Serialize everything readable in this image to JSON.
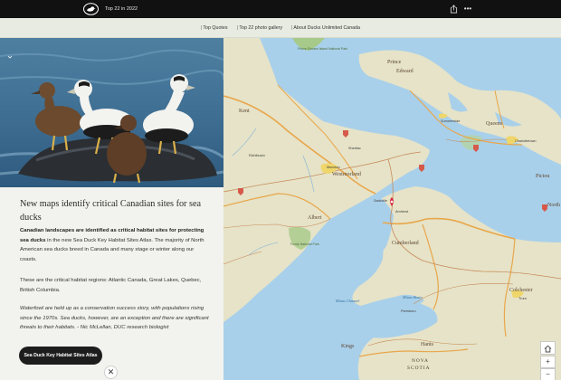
{
  "header": {
    "app_title": "Top 22 in 2022",
    "logo_icon": "duck-logo-icon",
    "share_icon": "share-icon",
    "more_icon": "more-icon"
  },
  "nav": {
    "items": [
      {
        "label": "Top Quotes"
      },
      {
        "label": "Top 22 photo gallery"
      },
      {
        "label": "About Ducks Unlimited Canada"
      }
    ]
  },
  "article": {
    "headline": "New maps identify critical Canadian sites for sea ducks",
    "p1_bold": "Canadian landscapes are identified as critical habitat sites for protecting sea ducks",
    "p1_rest": " in the new Sea Duck Key Habitat Sites Atlas. The majority of North American sea ducks breed in Canada and many stage or winter along our coasts.",
    "p2": "These are the critical habitat regions: Atlantic Canada, Great Lakes, Quebec, British Columbia.",
    "p3_quote": "Waterfowl are held up as a conservation success story, with populations rising since the 1970s. Sea ducks, however, are an exception and there are significant threats to their habitats.",
    "p3_attr": " - Nic McLellan, DUC research biologist",
    "cta_label": "Sea Duck Key Habitat Sites Atlas",
    "close_symbol": "✕"
  },
  "map": {
    "labels": {
      "prince": "Prince",
      "edward": "Edward",
      "kent": "Kent",
      "queens": "Queens",
      "westmorland": "Westmorland",
      "albert": "Albert",
      "cumberland": "Cumberland",
      "colchester": "Colchester",
      "pictou": "Pictou",
      "kings": "Kings",
      "hants": "Hants",
      "nova": "NOVA",
      "scotia": "SCOTIA",
      "north": "North",
      "prince_edward_island_np": "Prince Edward Island National Park",
      "fundy_np": "Fundy National Park",
      "minas_basin": "Minas Basin",
      "minas_channel": "Minas Channel",
      "moncton": "Moncton",
      "charlottetown": "Charlottetown",
      "amherst": "Amherst",
      "truro": "Truro",
      "sackville": "Sackville",
      "summerside": "Summerside",
      "shediac": "Shediac",
      "parrsboro": "Parrsboro",
      "richibucto": "Richibucto"
    },
    "controls": {
      "home_icon": "home-icon",
      "zoom_in": "+",
      "zoom_out": "−"
    },
    "colors": {
      "water": "#a9d0ea",
      "land": "#e6e3c8",
      "border": "#e9a64a",
      "road": "#c78a58"
    }
  }
}
